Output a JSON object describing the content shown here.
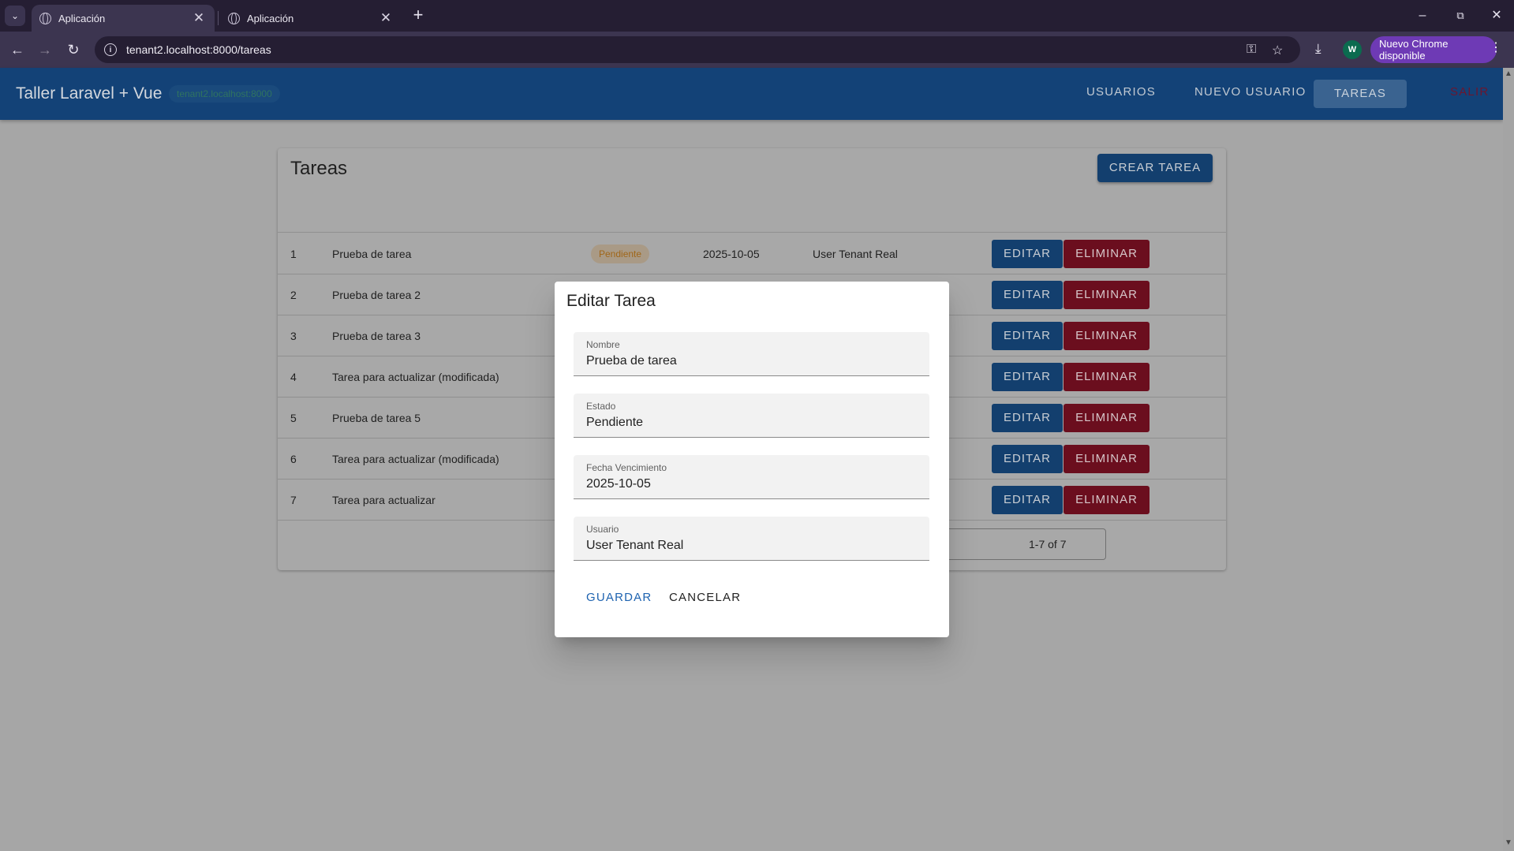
{
  "browser": {
    "tabs": [
      {
        "label": "Aplicación",
        "active": true
      },
      {
        "label": "Aplicación",
        "active": false
      }
    ],
    "url": "tenant2.localhost:8000/tareas",
    "update_label": "Nuevo Chrome disponible",
    "profile_initial": "W"
  },
  "app": {
    "title": "Taller Laravel + Vue",
    "tenant": "tenant2.localhost:8000",
    "nav": {
      "usuarios": "Usuarios",
      "nuevo_usuario": "Nuevo Usuario",
      "tareas": "Tareas",
      "salir": "Salir"
    }
  },
  "page": {
    "title": "Tareas",
    "create_button": "Crear Tarea",
    "edit_label": "Editar",
    "delete_label": "Eliminar",
    "pagination": "1-7 of 7",
    "rows": [
      {
        "id": "1",
        "name": "Prueba de tarea",
        "estado": "Pendiente",
        "fecha": "2025-10-05",
        "usuario": "User Tenant Real"
      },
      {
        "id": "2",
        "name": "Prueba de tarea 2"
      },
      {
        "id": "3",
        "name": "Prueba de tarea 3"
      },
      {
        "id": "4",
        "name": "Tarea para actualizar (modificada)"
      },
      {
        "id": "5",
        "name": "Prueba de tarea 5"
      },
      {
        "id": "6",
        "name": "Tarea para actualizar (modificada)"
      },
      {
        "id": "7",
        "name": "Tarea para actualizar"
      }
    ]
  },
  "dialog": {
    "title": "Editar Tarea",
    "fields": {
      "nombre": {
        "label": "Nombre",
        "value": "Prueba de tarea"
      },
      "estado": {
        "label": "Estado",
        "value": "Pendiente"
      },
      "fecha": {
        "label": "Fecha Vencimiento",
        "value": "2025-10-05"
      },
      "usuario": {
        "label": "Usuario",
        "value": "User Tenant Real"
      }
    },
    "save_label": "Guardar",
    "cancel_label": "Cancelar"
  },
  "colors": {
    "appbar": "#134277",
    "primary_button": "#133f6e",
    "danger_button": "#6b0e1e",
    "dialog_primary_text": "#1e63b0",
    "chrome_update_chip": "#6e3ab5"
  }
}
